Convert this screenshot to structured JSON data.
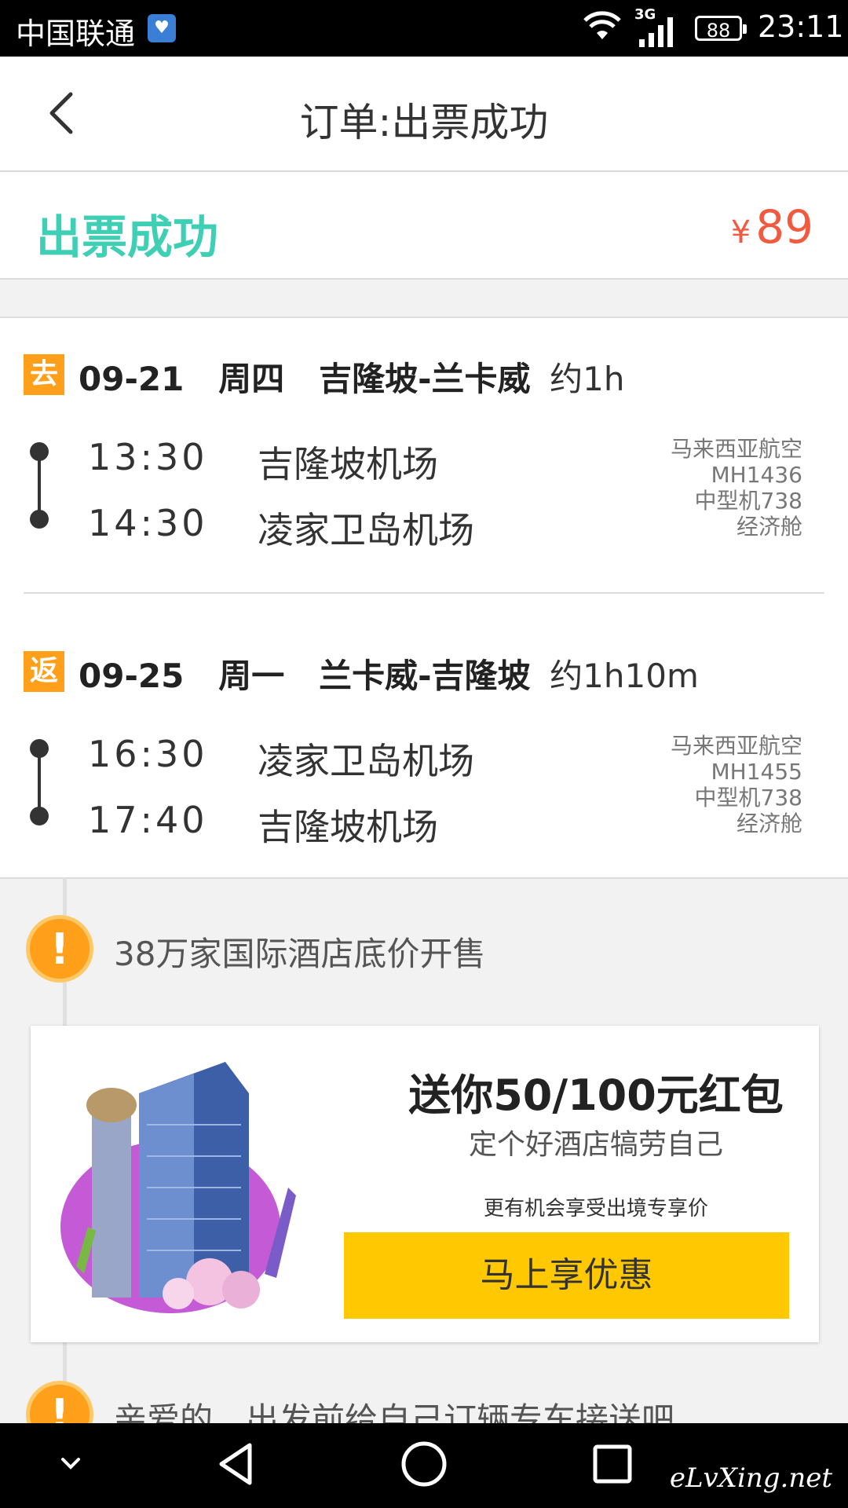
{
  "status_bar": {
    "carrier": "中国联通",
    "network": "3G",
    "battery": "88",
    "time": "23:11"
  },
  "header": {
    "title": "订单:出票成功",
    "back_icon": "chevron-left-icon"
  },
  "order_status": {
    "label": "出票成功",
    "currency": "¥",
    "price": "89",
    "status_color": "#3ecfb4",
    "price_color": "#f2593f"
  },
  "flights": [
    {
      "tag": "去",
      "date": "09-21",
      "weekday": "周四",
      "route": "吉隆坡-兰卡威",
      "duration": "约1h",
      "depart_time": "13:30",
      "depart_airport": "吉隆坡机场",
      "arrive_time": "14:30",
      "arrive_airport": "凌家卫岛机场",
      "airline": "马来西亚航空",
      "flight_no": "MH1436",
      "aircraft": "中型机738",
      "cabin": "经济舱"
    },
    {
      "tag": "返",
      "date": "09-25",
      "weekday": "周一",
      "route": "兰卡威-吉隆坡",
      "duration": "约1h10m",
      "depart_time": "16:30",
      "depart_airport": "凌家卫岛机场",
      "arrive_time": "17:40",
      "arrive_airport": "吉隆坡机场",
      "airline": "马来西亚航空",
      "flight_no": "MH1455",
      "aircraft": "中型机738",
      "cabin": "经济舱"
    }
  ],
  "alerts": [
    {
      "icon": "exclamation-icon",
      "text": "38万家国际酒店底价开售"
    },
    {
      "icon": "exclamation-icon",
      "text": "亲爱的，出发前给自己订辆专车接送吧"
    }
  ],
  "promo": {
    "title": "送你50/100元红包",
    "subtitle": "定个好酒店犒劳自己",
    "note": "更有机会享受出境专享价",
    "button": "马上享优惠",
    "button_color": "#ffc800"
  },
  "nav_bar": {
    "watermark": "eLvXing.net"
  }
}
